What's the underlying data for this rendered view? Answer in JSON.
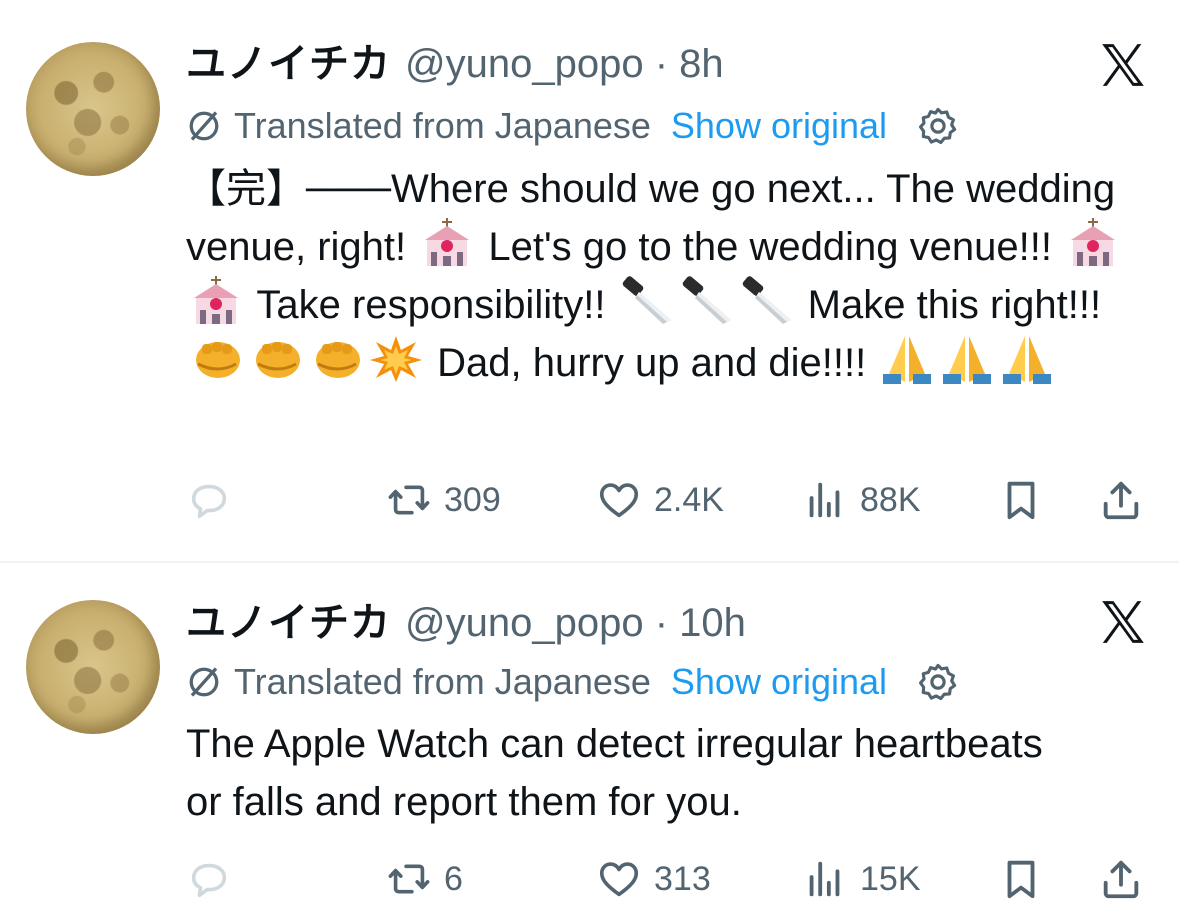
{
  "tweets": [
    {
      "name": "ユノイチカ",
      "handle": "@yuno_popo",
      "sep": "·",
      "time": "8h",
      "translated_label": "Translated from Japanese",
      "show_original": "Show original",
      "text_parts": [
        "【完】───Where should we go next... The wedding venue, right! ",
        " Let's go to the wedding venue!!! ",
        " Take responsibility!! ",
        " Make this right!!! ",
        " Dad, hurry up and die!!!! "
      ],
      "emoji": {
        "chapel": "wedding-chapel-emoji",
        "knife": "kitchen-knife-emoji",
        "fist": "oncoming-fist-emoji",
        "collision": "collision-emoji",
        "pray": "folded-hands-emoji"
      },
      "retweets": "309",
      "likes": "2.4K",
      "views": "88K"
    },
    {
      "name": "ユノイチカ",
      "handle": "@yuno_popo",
      "sep": "·",
      "time": "10h",
      "translated_label": "Translated from Japanese",
      "show_original": "Show original",
      "text": "The Apple Watch can detect irregular heartbeats or falls and report them for you.",
      "retweets": "6",
      "likes": "313",
      "views": "15K"
    }
  ],
  "colors": {
    "text": "#0f1419",
    "muted": "#536471",
    "link": "#1d9bf0",
    "divider": "#eff3f4"
  },
  "icons": [
    "x-logo-icon",
    "translate-icon",
    "gear-icon",
    "reply-icon",
    "retweet-icon",
    "like-icon",
    "views-icon",
    "bookmark-icon",
    "share-icon"
  ]
}
